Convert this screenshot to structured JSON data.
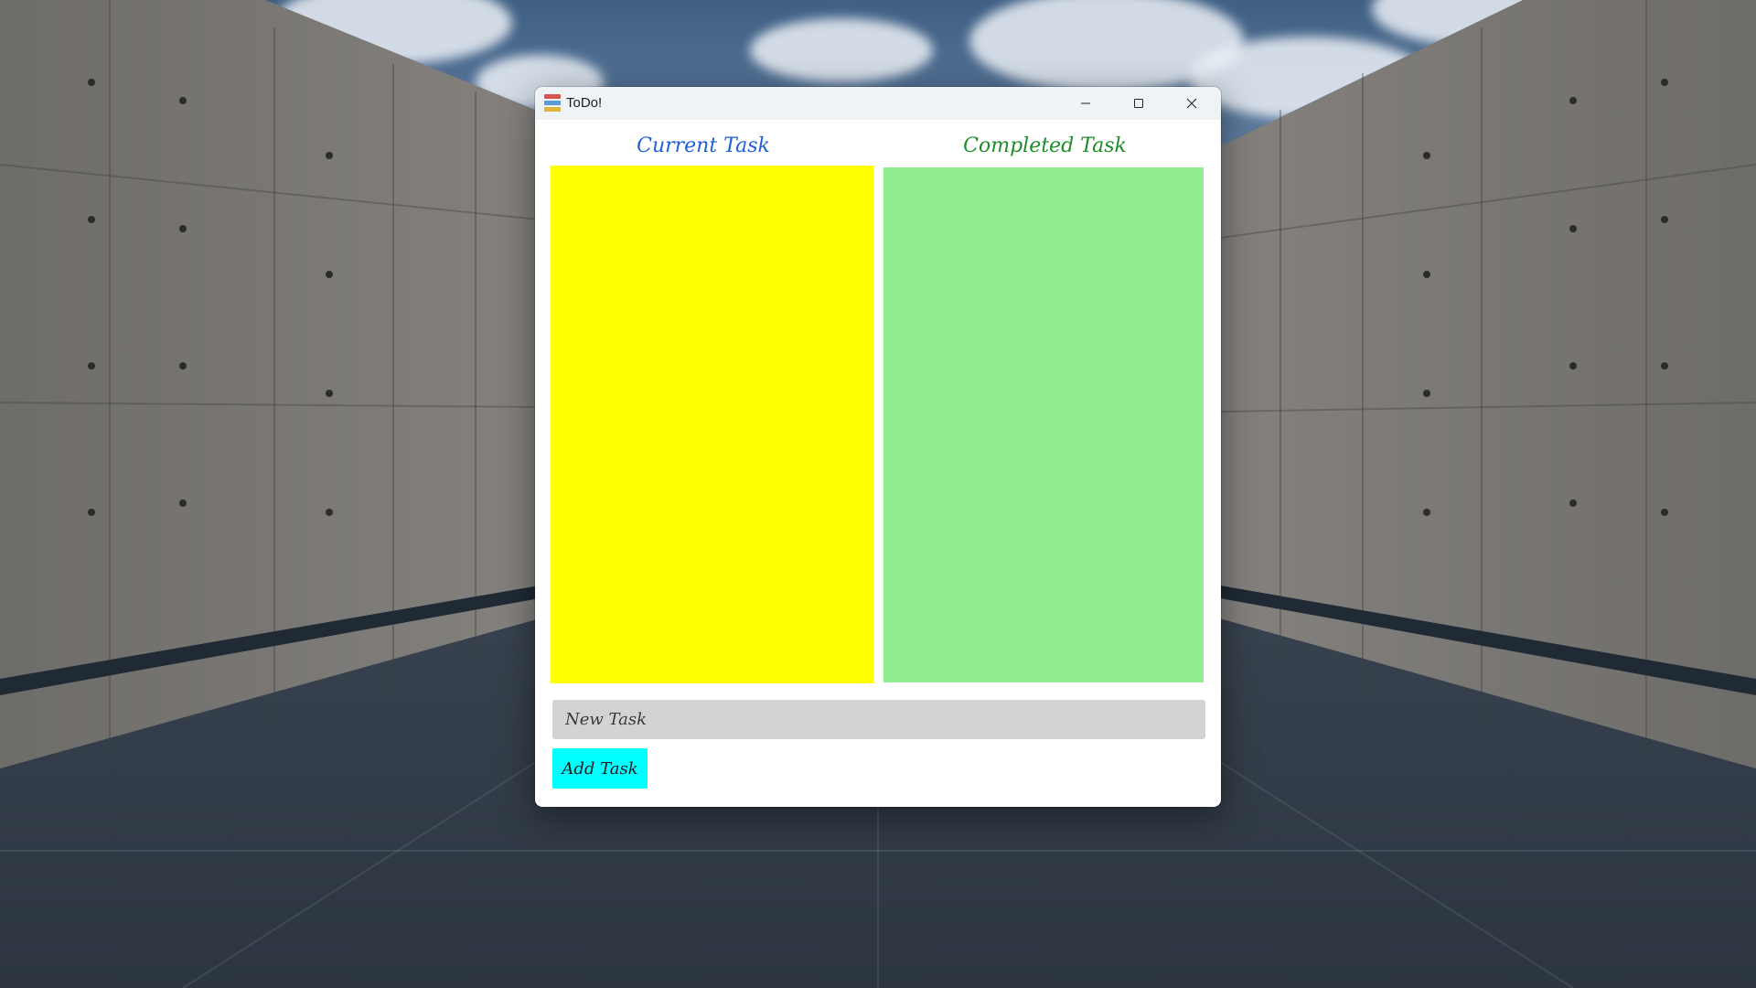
{
  "window": {
    "title": "ToDo!",
    "controls": {
      "minimize": "minimize-icon",
      "maximize": "maximize-icon",
      "close": "close-icon"
    }
  },
  "columns": {
    "current": {
      "header": "Current Task",
      "header_color": "#1e5fd6",
      "background": "#ffff00",
      "items": []
    },
    "completed": {
      "header": "Completed Task",
      "header_color": "#1f8d2a",
      "background": "#90ee90",
      "items": []
    }
  },
  "new_task": {
    "placeholder": "New Task",
    "value": ""
  },
  "add_button": {
    "label": "Add Task",
    "color": "#00ffff"
  }
}
